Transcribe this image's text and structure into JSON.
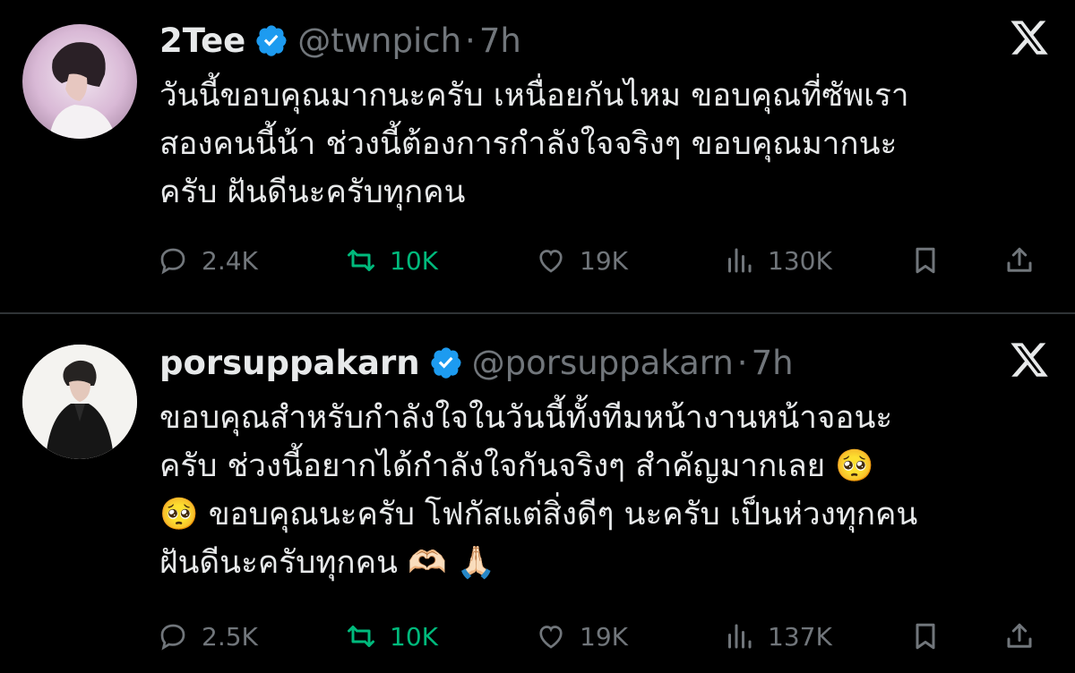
{
  "tweets": [
    {
      "name": "2Tee",
      "handle": "@twnpich",
      "separator": "·",
      "time": "7h",
      "text_lines": [
        "วันนี้ขอบคุณมากนะครับ เหนื่อยกันไหม ขอบคุณที่ซัพเรา",
        "สองคนนี้น้า ช่วงนี้ต้องการกำลังใจจริงๆ ขอบคุณมากนะ",
        "ครับ ฝันดีนะครับทุกคน"
      ],
      "stats": {
        "replies": "2.4K",
        "retweets": "10K",
        "likes": "19K",
        "views": "130K"
      }
    },
    {
      "name": "porsuppakarn",
      "handle": "@porsuppakarn",
      "separator": "·",
      "time": "7h",
      "text_lines": [
        "ขอบคุณสำหรับกำลังใจในวันนี้ทั้งทีมหน้างานหน้าจอนะ",
        "ครับ ช่วงนี้อยากได้กำลังใจกันจริงๆ สำคัญมากเลย 🥺",
        "🥺 ขอบคุณนะครับ โฟกัสแต่สิ่งดีๆ นะครับ เป็นห่วงทุกคน",
        "ฝันดีนะครับทุกคน 🫶🏻 🙏🏻"
      ],
      "stats": {
        "replies": "2.5K",
        "retweets": "10K",
        "likes": "19K",
        "views": "137K"
      }
    }
  ],
  "colors": {
    "background": "#000000",
    "text": "#e7e9ea",
    "muted": "#71767b",
    "retweet_active": "#00ba7c",
    "verified": "#1d9bf0",
    "divider": "#2f3336"
  },
  "icons": [
    "verified-badge-icon",
    "x-logo-icon",
    "reply-icon",
    "retweet-icon",
    "like-icon",
    "views-icon",
    "bookmark-icon",
    "share-icon"
  ]
}
